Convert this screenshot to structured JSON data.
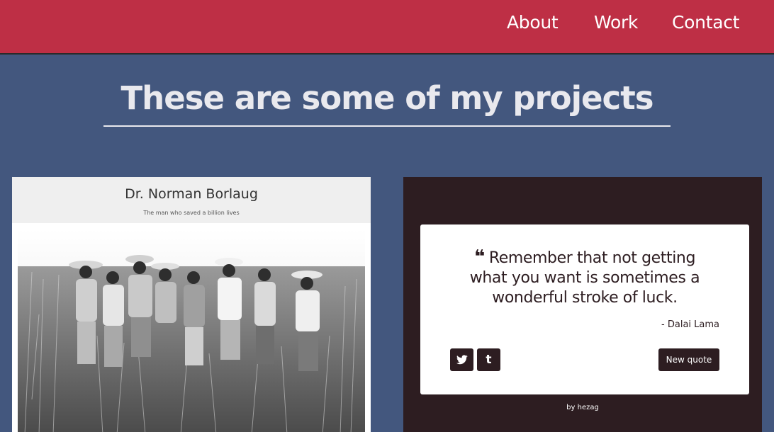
{
  "nav": {
    "items": [
      {
        "label": "About"
      },
      {
        "label": "Work"
      },
      {
        "label": "Contact"
      }
    ]
  },
  "section": {
    "title": "These are some of my projects"
  },
  "projects": [
    {
      "title": "Dr. Norman Borlaug",
      "subtitle": "The man who saved a billion lives",
      "image": "black-and-white photo of men in hats standing in a wheat field"
    },
    {
      "quote": "Remember that not getting what you want is sometimes a wonderful stroke of luck.",
      "author": "- Dalai Lama",
      "new_quote_label": "New quote",
      "byline": "by hezag",
      "share_icons": [
        "twitter-icon",
        "tumblr-icon"
      ]
    }
  ],
  "colors": {
    "navbar": "#be2f45",
    "background": "#43577e",
    "quote_card": "#2d1d21",
    "title_text": "#e9e9ee"
  }
}
